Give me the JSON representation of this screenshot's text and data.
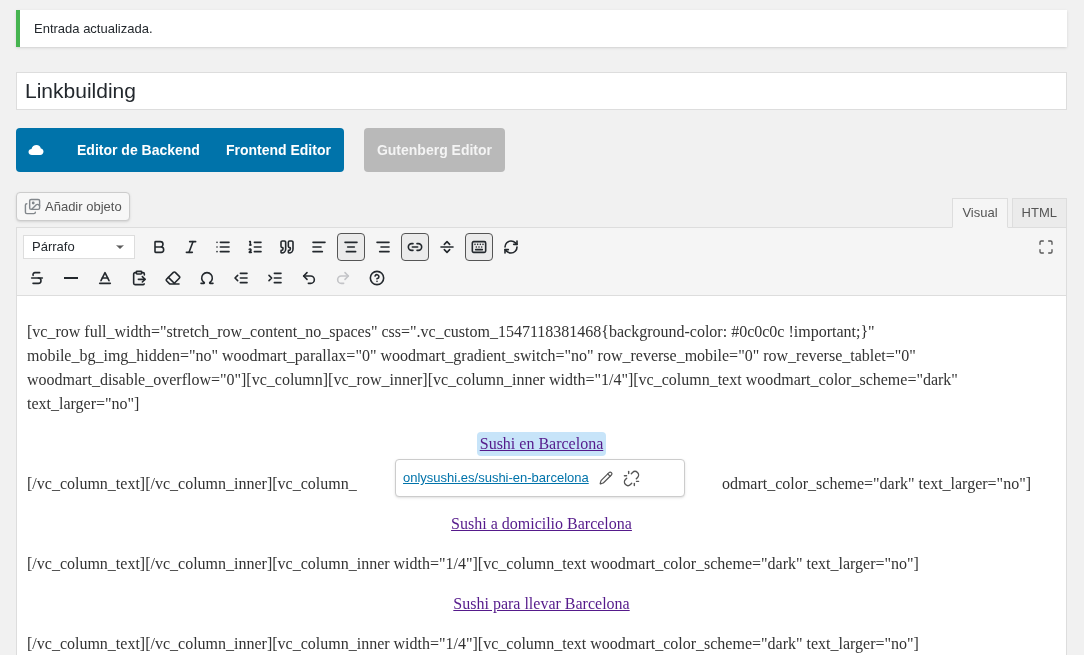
{
  "notice": {
    "text": "Entrada actualizada."
  },
  "title_field": {
    "value": "Linkbuilding"
  },
  "builder_buttons": [
    {
      "label": "Editor de Backend",
      "kind": "primary"
    },
    {
      "label": "Frontend Editor",
      "kind": "primary"
    },
    {
      "label": "Gutenberg Editor",
      "kind": "disabled"
    }
  ],
  "add_media": {
    "label": "Añadir objeto"
  },
  "tabs": [
    {
      "label": "Visual",
      "selected": true
    },
    {
      "label": "HTML",
      "selected": false
    }
  ],
  "format_select": {
    "value": "Párrafo"
  },
  "toolbar_row1": [
    {
      "kind": "bold",
      "active": false
    },
    {
      "kind": "italic",
      "active": false
    },
    {
      "kind": "bullets",
      "active": false
    },
    {
      "kind": "numbers",
      "active": false
    },
    {
      "kind": "quote",
      "active": false
    },
    {
      "kind": "align-left",
      "active": false
    },
    {
      "kind": "align-center",
      "active": true
    },
    {
      "kind": "align-right",
      "active": false
    },
    {
      "kind": "link",
      "active": true
    },
    {
      "kind": "more",
      "active": false
    },
    {
      "kind": "toolbar",
      "active": true
    },
    {
      "kind": "refresh",
      "active": false
    }
  ],
  "toolbar_row2": [
    {
      "kind": "strike",
      "disabled": false
    },
    {
      "kind": "hr",
      "disabled": false
    },
    {
      "kind": "color",
      "disabled": false
    },
    {
      "kind": "paste",
      "disabled": false
    },
    {
      "kind": "eraser",
      "disabled": false
    },
    {
      "kind": "omega",
      "disabled": false
    },
    {
      "kind": "outdent",
      "disabled": false
    },
    {
      "kind": "indent",
      "disabled": false
    },
    {
      "kind": "undo",
      "disabled": false
    },
    {
      "kind": "redo",
      "disabled": true
    },
    {
      "kind": "help",
      "disabled": false
    }
  ],
  "content": [
    {
      "kind": "paragraph",
      "text": "[vc_row full_width=\"stretch_row_content_no_spaces\" css=\".vc_custom_1547118381468{background-color: #0c0c0c !important;}\" mobile_bg_img_hidden=\"no\" woodmart_parallax=\"0\" woodmart_gradient_switch=\"no\" row_reverse_mobile=\"0\" row_reverse_tablet=\"0\" woodmart_disable_overflow=\"0\"][vc_column][vc_row_inner][vc_column_inner width=\"1/4\"][vc_column_text woodmart_color_scheme=\"dark\" text_larger=\"no\"]"
    },
    {
      "kind": "link",
      "text": "Sushi en Barcelona",
      "selected": true
    },
    {
      "kind": "covered",
      "left": "[/vc_column_text][/vc_column_inner][vc_column_",
      "right": "odmart_color_scheme=\"dark\" text_larger=\"no\"]"
    },
    {
      "kind": "link",
      "text": "Sushi a domicilio Barcelona",
      "selected": false
    },
    {
      "kind": "paragraph",
      "text": "[/vc_column_text][/vc_column_inner][vc_column_inner width=\"1/4\"][vc_column_text woodmart_color_scheme=\"dark\" text_larger=\"no\"]"
    },
    {
      "kind": "link",
      "text": "Sushi para llevar Barcelona",
      "selected": false
    },
    {
      "kind": "paragraph",
      "text": "[/vc_column_text][/vc_column_inner][vc_column_inner width=\"1/4\"][vc_column_text woodmart_color_scheme=\"dark\" text_larger=\"no\"]"
    }
  ],
  "link_popup": {
    "url": "onlysushi.es/sushi-en-barcelona"
  }
}
